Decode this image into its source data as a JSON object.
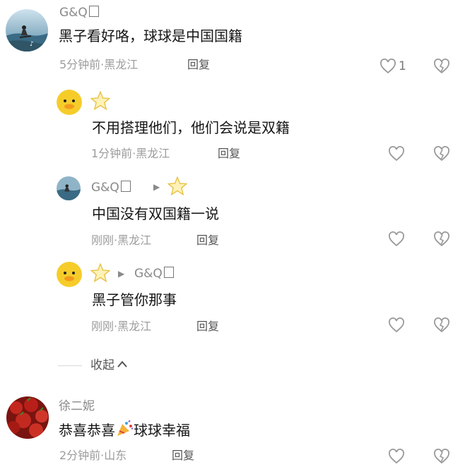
{
  "comments": [
    {
      "user": "G&Q",
      "text": "黑子看好咯，球球是中国国籍",
      "time_location": "5分钟前·黑龙江",
      "reply_label": "回复",
      "like_count": "1"
    },
    {
      "text": "不用搭理他们，他们会说是双籍",
      "time_location": "1分钟前·黑龙江",
      "reply_label": "回复"
    },
    {
      "user": "G&Q",
      "text": "中国没有双国籍一说",
      "time_location": "刚刚·黑龙江",
      "reply_label": "回复"
    },
    {
      "reply_to": "G&Q",
      "text": "黑子管你那事",
      "time_location": "刚刚·黑龙江",
      "reply_label": "回复"
    },
    {
      "user": "徐二妮",
      "text_before": "恭喜恭喜",
      "text_after": "球球幸福",
      "time_location": "2分钟前·山东",
      "reply_label": "回复"
    }
  ],
  "collapse_label": "收起",
  "icons": {
    "like": "heart-outline-icon",
    "dislike": "dislike-icon",
    "badge": "star-icon",
    "reply_arrow": "triangle-right-icon",
    "collapse": "chevron-up-icon",
    "emoji": "party-popper-icon"
  },
  "colors": {
    "text": "#161616",
    "meta": "#9c9c9c",
    "name": "#8a8a8a"
  }
}
